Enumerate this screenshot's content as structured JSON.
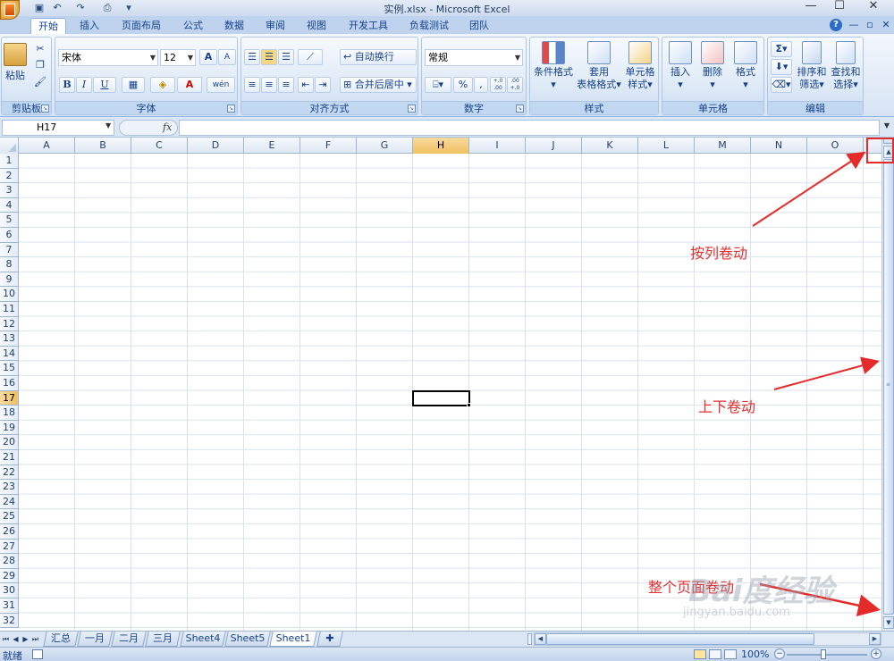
{
  "window": {
    "title": "实例.xlsx - Microsoft Excel",
    "minimize": "—",
    "restore": "☐",
    "close": "✕"
  },
  "qat": {
    "save_icon": "save-icon",
    "undo_icon": "undo-icon",
    "redo_icon": "redo-icon",
    "customize": "▾"
  },
  "ribbon_tabs": [
    {
      "label": "开始",
      "active": true
    },
    {
      "label": "插入"
    },
    {
      "label": "页面布局"
    },
    {
      "label": "公式"
    },
    {
      "label": "数据"
    },
    {
      "label": "审阅"
    },
    {
      "label": "视图"
    },
    {
      "label": "开发工具"
    },
    {
      "label": "负载测试"
    },
    {
      "label": "团队"
    }
  ],
  "ribbon_right": {
    "help": "?",
    "minimize": "—",
    "restore": "▫",
    "close": "✕"
  },
  "clipboard": {
    "paste": "粘贴",
    "group": "剪贴板"
  },
  "font": {
    "name": "宋体",
    "size": "12",
    "grow": "A",
    "shrink": "A",
    "bold": "B",
    "italic": "I",
    "underline": "U",
    "phonetic": "wén",
    "group": "字体"
  },
  "alignment": {
    "wrap": "自动换行",
    "merge": "合并后居中",
    "group": "对齐方式"
  },
  "number": {
    "format": "常规",
    "percent": "%",
    "comma": ",",
    "inc_decimal": "+.0 .00",
    "dec_decimal": ".00 +.0",
    "group": "数字"
  },
  "styles": {
    "conditional_1": "条件格式",
    "table_1": "套用",
    "table_2": "表格格式",
    "cell_1": "单元格",
    "cell_2": "样式",
    "group": "样式"
  },
  "cells": {
    "insert": "插入",
    "delete": "删除",
    "format": "格式",
    "group": "单元格"
  },
  "editing": {
    "sort_1": "排序和",
    "sort_2": "筛选",
    "find_1": "查找和",
    "find_2": "选择",
    "autosum": "Σ",
    "group": "编辑"
  },
  "formula_bar": {
    "name_box": "H17",
    "fx": "fx",
    "formula": ""
  },
  "sheet": {
    "columns": [
      "A",
      "B",
      "C",
      "D",
      "E",
      "F",
      "G",
      "H",
      "I",
      "J",
      "K",
      "L",
      "M",
      "N",
      "O"
    ],
    "rows": [
      "1",
      "2",
      "3",
      "4",
      "5",
      "6",
      "7",
      "8",
      "9",
      "10",
      "11",
      "12",
      "13",
      "14",
      "15",
      "16",
      "17",
      "18",
      "19",
      "20",
      "21",
      "22",
      "23",
      "24",
      "25",
      "26",
      "27",
      "28",
      "29",
      "30",
      "31",
      "32"
    ],
    "active_col": "H",
    "active_row": "17"
  },
  "sheet_tabs": [
    {
      "label": "汇总"
    },
    {
      "label": "一月"
    },
    {
      "label": "二月"
    },
    {
      "label": "三月"
    },
    {
      "label": "Sheet4"
    },
    {
      "label": "Sheet5"
    },
    {
      "label": "Sheet1",
      "active": true
    }
  ],
  "status": {
    "text": "就绪",
    "zoom": "100%",
    "zoom_minus": "−",
    "zoom_plus": "+"
  },
  "annotations": {
    "by_column": "按列卷动",
    "up_down": "上下卷动",
    "whole_page": "整个页面卷动",
    "accent": "#e03030"
  },
  "watermark": {
    "brand": "Bai度经验",
    "url": "jingyan.baidu.com"
  }
}
